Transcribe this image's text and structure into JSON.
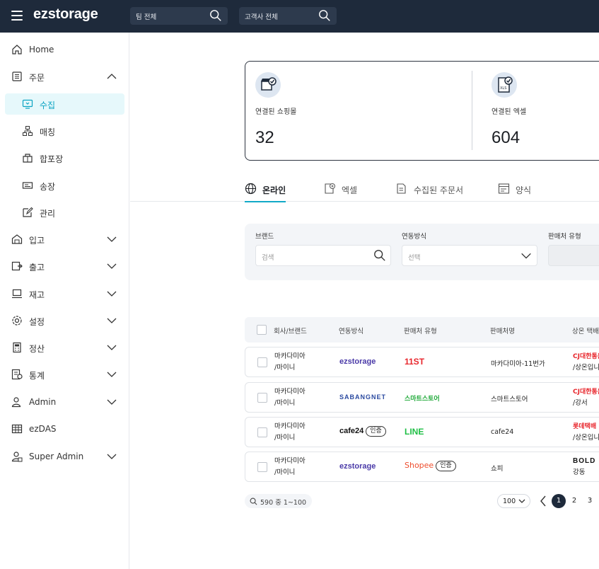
{
  "header": {
    "logo": "ezstorage",
    "team_search_label": "팀 전체",
    "customer_search_label": "고객사 전체"
  },
  "sidebar": {
    "items": [
      {
        "label": "Home",
        "icon": "home-icon"
      },
      {
        "label": "주문",
        "icon": "order-list-icon",
        "expanded": true
      },
      {
        "label": "수집",
        "icon": "collect-icon",
        "sub": true,
        "active": true
      },
      {
        "label": "매칭",
        "icon": "matching-icon",
        "sub": true
      },
      {
        "label": "합포장",
        "icon": "package-icon",
        "sub": true
      },
      {
        "label": "송장",
        "icon": "invoice-icon",
        "sub": true
      },
      {
        "label": "관리",
        "icon": "edit-icon",
        "sub": true
      },
      {
        "label": "입고",
        "icon": "inbound-icon"
      },
      {
        "label": "출고",
        "icon": "outbound-icon"
      },
      {
        "label": "재고",
        "icon": "stock-icon"
      },
      {
        "label": "설정",
        "icon": "settings-icon"
      },
      {
        "label": "정산",
        "icon": "settlement-icon"
      },
      {
        "label": "통계",
        "icon": "stats-icon"
      },
      {
        "label": "Admin",
        "icon": "admin-icon"
      },
      {
        "label": "ezDAS",
        "icon": "ezdas-icon"
      },
      {
        "label": "Super Admin",
        "icon": "super-admin-icon"
      }
    ]
  },
  "stats": {
    "shops_label": "연결된 쇼핑몰",
    "shops_value": "32",
    "excel_label": "연결된 엑셀",
    "excel_value": "604"
  },
  "tabs": [
    {
      "label": "온라인",
      "active": true
    },
    {
      "label": "엑셀"
    },
    {
      "label": "수집된 주문서"
    },
    {
      "label": "양식"
    }
  ],
  "filters": {
    "brand_label": "브랜드",
    "brand_placeholder": "검색",
    "link_label": "연동방식",
    "link_placeholder": "선택",
    "seller_type_label": "판매처 유형"
  },
  "table": {
    "headers": [
      "회사/브랜드",
      "연동방식",
      "판매처 유형",
      "판매처명",
      "상온 택배사"
    ],
    "rows": [
      {
        "company": "마카다미아",
        "brand": "/마이니",
        "link": "ezstorage",
        "link_badge": "",
        "seller_type": "11ST",
        "seller_type_badge": "",
        "seller_name": "마카다미아-11번가",
        "carrier": "CJ대한통운",
        "carrier_sub": "/상온입니"
      },
      {
        "company": "마카다미아",
        "brand": "/마이니",
        "link": "SABANGNET",
        "link_badge": "",
        "seller_type": "스마트스토어",
        "seller_type_badge": "",
        "seller_name": "스마트스토어",
        "carrier": "CJ대한통운",
        "carrier_sub": "/강서"
      },
      {
        "company": "마카다미아",
        "brand": "/마이니",
        "link": "cafe24",
        "link_badge": "인증",
        "seller_type": "LINE",
        "seller_type_badge": "",
        "seller_name": "cafe24",
        "carrier": "롯데택배",
        "carrier_sub": "/상온입니"
      },
      {
        "company": "마카다미아",
        "brand": "/마이니",
        "link": "ezstorage",
        "link_badge": "",
        "seller_type": "Shopee",
        "seller_type_badge": "인증",
        "seller_name": "쇼피",
        "carrier": "BOLD",
        "carrier_sub": "강동"
      }
    ]
  },
  "pagination": {
    "summary": "590 중 1~100",
    "page_size": "100",
    "pages": [
      "1",
      "2",
      "3"
    ],
    "current": "1"
  },
  "colors": {
    "topbar": "#1e2a3b",
    "accent": "#12a9c8",
    "active_bg": "#e6f8fb"
  }
}
